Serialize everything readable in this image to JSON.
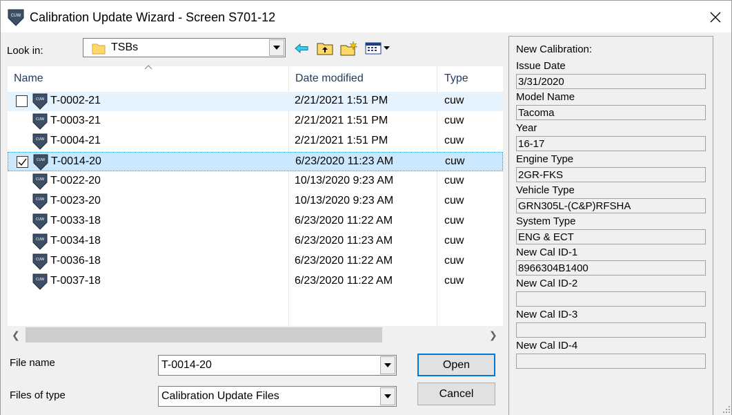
{
  "window": {
    "title": "Calibration Update Wizard - Screen S701-12",
    "logo_text": "CUW"
  },
  "toolbar": {
    "lookin_label": "Look in:",
    "lookin_value": "TSBs",
    "icons": [
      "back-arrow-icon",
      "up-folder-icon",
      "new-folder-icon",
      "view-menu-icon"
    ]
  },
  "filelist": {
    "columns": {
      "name": "Name",
      "date": "Date modified",
      "type": "Type"
    },
    "rows": [
      {
        "name": "T-0002-21",
        "date": "2/21/2021 1:51 PM",
        "type": "cuw",
        "state": "hover",
        "checkbox": "unchecked"
      },
      {
        "name": "T-0003-21",
        "date": "2/21/2021 1:51 PM",
        "type": "cuw",
        "state": "",
        "checkbox": ""
      },
      {
        "name": "T-0004-21",
        "date": "2/21/2021 1:51 PM",
        "type": "cuw",
        "state": "",
        "checkbox": ""
      },
      {
        "name": "T-0014-20",
        "date": "6/23/2020 11:23 AM",
        "type": "cuw",
        "state": "selected",
        "checkbox": "checked"
      },
      {
        "name": "T-0022-20",
        "date": "10/13/2020 9:23 AM",
        "type": "cuw",
        "state": "",
        "checkbox": ""
      },
      {
        "name": "T-0023-20",
        "date": "10/13/2020 9:23 AM",
        "type": "cuw",
        "state": "",
        "checkbox": ""
      },
      {
        "name": "T-0033-18",
        "date": "6/23/2020 11:22 AM",
        "type": "cuw",
        "state": "",
        "checkbox": ""
      },
      {
        "name": "T-0034-18",
        "date": "6/23/2020 11:23 AM",
        "type": "cuw",
        "state": "",
        "checkbox": ""
      },
      {
        "name": "T-0036-18",
        "date": "6/23/2020 11:22 AM",
        "type": "cuw",
        "state": "",
        "checkbox": ""
      },
      {
        "name": "T-0037-18",
        "date": "6/23/2020 11:22 AM",
        "type": "cuw",
        "state": "",
        "checkbox": ""
      }
    ]
  },
  "file_name": {
    "label": "File name",
    "value": "T-0014-20"
  },
  "files_of_type": {
    "label": "Files of type",
    "value": "Calibration Update Files"
  },
  "buttons": {
    "open": "Open",
    "cancel": "Cancel"
  },
  "panel": {
    "heading": "New Calibration:",
    "fields": [
      {
        "label": "Issue Date",
        "value": "3/31/2020"
      },
      {
        "label": "Model Name",
        "value": "Tacoma"
      },
      {
        "label": "Year",
        "value": "16-17"
      },
      {
        "label": "Engine Type",
        "value": "2GR-FKS"
      },
      {
        "label": "Vehicle Type",
        "value": "GRN305L-(C&P)RFSHA"
      },
      {
        "label": "System Type",
        "value": "ENG & ECT"
      },
      {
        "label": "New Cal ID-1",
        "value": "8966304B1400"
      },
      {
        "label": "New Cal ID-2",
        "value": ""
      },
      {
        "label": "New Cal ID-3",
        "value": ""
      },
      {
        "label": "New Cal ID-4",
        "value": ""
      }
    ]
  },
  "colors": {
    "selection": "#cce8ff",
    "hover": "#e5f3ff",
    "accent": "#0078d7",
    "header_text": "#1e395b"
  }
}
